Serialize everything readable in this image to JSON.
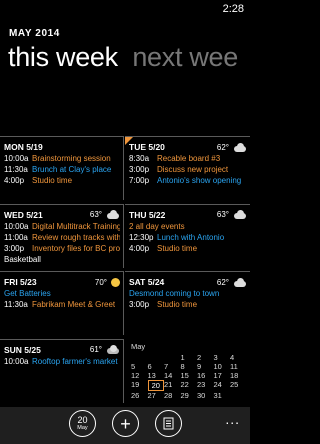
{
  "status": {
    "time": "2:28"
  },
  "header": {
    "month": "MAY 2014"
  },
  "pivot": {
    "active": "this week",
    "next": "next wee"
  },
  "colors": {
    "accent": "#f0963c",
    "link": "#2aa4f0"
  },
  "days": [
    {
      "label": "MON 5/19",
      "temp": "",
      "weather": "",
      "events": [
        {
          "time": "10:00a",
          "name": "Brainstorming session",
          "color": "orange"
        },
        {
          "time": "11:30a",
          "name": "Brunch at Clay's place",
          "color": "blue"
        },
        {
          "time": "4:00p",
          "name": "Studio time",
          "color": "orange"
        }
      ]
    },
    {
      "label": "TUE 5/20",
      "temp": "62°",
      "weather": "cloud-icon",
      "events": [
        {
          "time": "8:30a",
          "name": "Recable board #3",
          "color": "orange"
        },
        {
          "time": "3:00p",
          "name": "Discuss new project",
          "color": "orange"
        },
        {
          "time": "7:00p",
          "name": "Antonio's show opening",
          "color": "blue"
        }
      ]
    },
    {
      "label": "WED 5/21",
      "temp": "63°",
      "weather": "cloud-icon",
      "events": [
        {
          "time": "10:00a",
          "name": "Digital Multitrack Training",
          "color": "orange"
        },
        {
          "time": "11:00a",
          "name": "Review rough tracks with",
          "color": "orange"
        },
        {
          "time": "3:00p",
          "name": "Inventory files for BC pro",
          "color": "orange"
        },
        {
          "time": "",
          "name": "Basketball",
          "color": "white"
        }
      ]
    },
    {
      "label": "THU 5/22",
      "temp": "63°",
      "weather": "cloud-icon",
      "events": [
        {
          "time": "",
          "name": "2 all day events",
          "color": "orange"
        },
        {
          "time": "12:30p",
          "name": "Lunch with Antonio",
          "color": "blue"
        },
        {
          "time": "4:00p",
          "name": "Studio time",
          "color": "orange"
        }
      ]
    },
    {
      "label": "FRI 5/23",
      "temp": "70°",
      "weather": "sun-icon",
      "events": [
        {
          "time": "",
          "name": "Get Batteries",
          "color": "blue"
        },
        {
          "time": "11:30a",
          "name": "Fabrikam Meet & Greet",
          "color": "orange"
        }
      ]
    },
    {
      "label": "SAT 5/24",
      "temp": "62°",
      "weather": "cloud-icon",
      "events": [
        {
          "time": "",
          "name": "Desmond coming to town",
          "color": "blue"
        },
        {
          "time": "3:00p",
          "name": "Studio time",
          "color": "orange"
        }
      ]
    },
    {
      "label": "SUN 5/25",
      "temp": "61°",
      "weather": "rain-icon",
      "events": [
        {
          "time": "10:00a",
          "name": "Rooftop farmer's market",
          "color": "blue"
        }
      ]
    }
  ],
  "mini_calendar": {
    "month": "May",
    "weeks": [
      [
        "",
        "",
        "",
        "1",
        "2",
        "3",
        "4"
      ],
      [
        "5",
        "6",
        "7",
        "8",
        "9",
        "10",
        "11"
      ],
      [
        "12",
        "13",
        "14",
        "15",
        "16",
        "17",
        "18"
      ],
      [
        "19",
        "20",
        "21",
        "22",
        "23",
        "24",
        "25"
      ],
      [
        "26",
        "27",
        "28",
        "29",
        "30",
        "31",
        ""
      ]
    ],
    "today": "20"
  },
  "appbar": {
    "today_num": "20",
    "today_month": "May",
    "add": "+",
    "more": "..."
  }
}
